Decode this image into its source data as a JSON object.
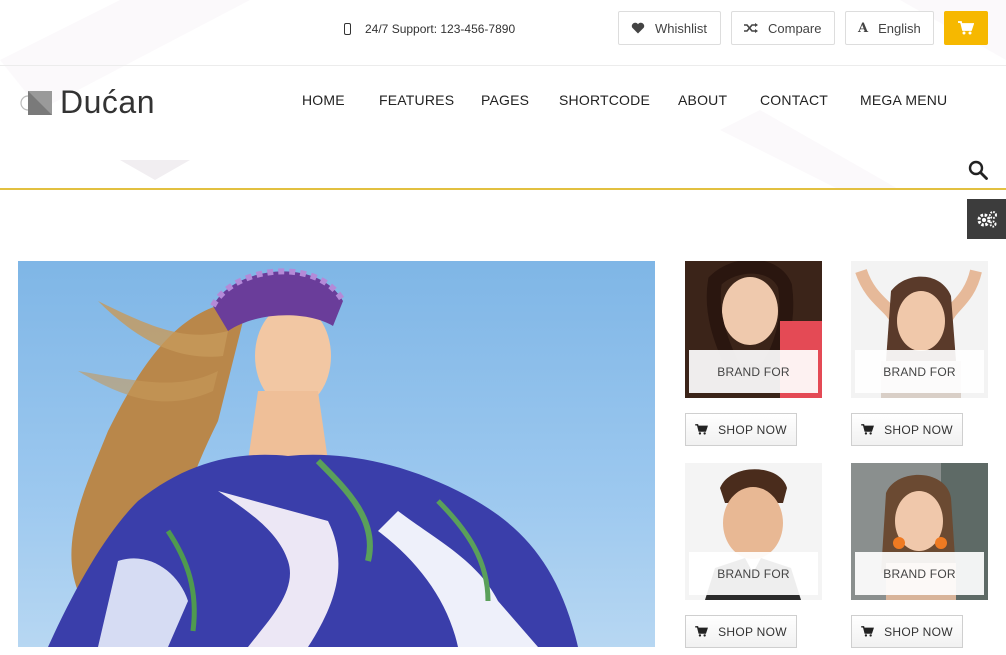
{
  "topbar": {
    "support_text": "24/7 Support: 123-456-7890",
    "wishlist_label": "Whishlist",
    "compare_label": "Compare",
    "language_label": "English"
  },
  "header": {
    "logo_text": "Dućan",
    "nav": [
      "HOME",
      "FEATURES",
      "PAGES",
      "SHORTCODE",
      "ABOUT",
      "CONTACT",
      "MEGA MENU"
    ]
  },
  "products": [
    {
      "label": "BRAND FOR",
      "button": "SHOP NOW"
    },
    {
      "label": "BRAND FOR",
      "button": "SHOP NOW"
    },
    {
      "label": "BRAND FOR",
      "button": "SHOP NOW"
    },
    {
      "label": "BRAND FOR",
      "button": "SHOP NOW"
    }
  ],
  "colors": {
    "accent": "#f6b800",
    "header_rule": "#e2c040",
    "settings_panel": "#3c3c3c"
  },
  "icons": [
    "phone-icon",
    "heart-icon",
    "shuffle-icon",
    "language-icon",
    "cart-icon",
    "search-icon",
    "gears-icon"
  ]
}
